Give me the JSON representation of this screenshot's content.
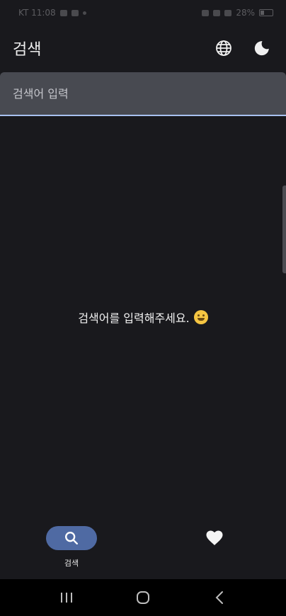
{
  "status_bar": {
    "time": "KT 11:08",
    "battery": "28%"
  },
  "app_bar": {
    "title": "검색",
    "icons": [
      "globe-icon",
      "moon-icon"
    ]
  },
  "search": {
    "placeholder": "검색어 입력",
    "value": ""
  },
  "empty_state": {
    "message": "검색어를 입력해주세요.",
    "emoji": "smiling-face-icon"
  },
  "bottom_nav": {
    "items": [
      {
        "label": "검색",
        "icon": "search-icon",
        "active": true
      },
      {
        "label": "",
        "icon": "heart-icon",
        "active": false
      }
    ]
  },
  "colors": {
    "background": "#19191d",
    "search_field": "#484a51",
    "focus_underline": "#a9c1f0",
    "active_pill": "#4f6aa3"
  },
  "system_nav": {
    "buttons": [
      "recent-apps-icon",
      "home-icon",
      "back-icon"
    ]
  }
}
